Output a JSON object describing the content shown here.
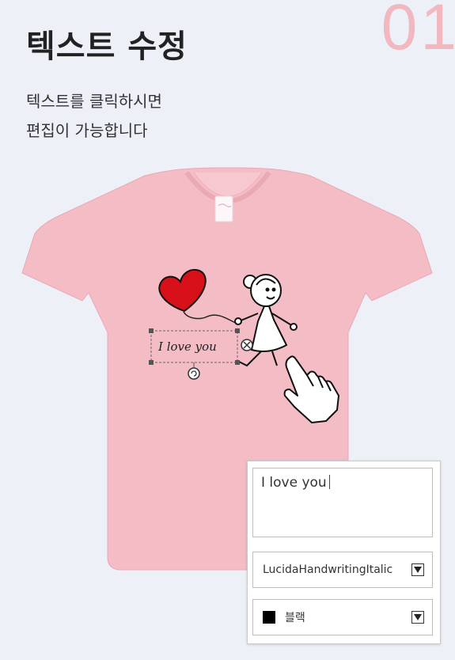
{
  "step": {
    "number": "01"
  },
  "header": {
    "title": "텍스트 수정"
  },
  "description": {
    "line1": "텍스트를 클릭하시면",
    "line2": "편집이 가능합니다"
  },
  "shirt": {
    "color": "#f4bcc5",
    "design_text": "I love you",
    "heart_color": "#d8101a"
  },
  "editor": {
    "text_value": "I love you",
    "font_value": "LucidaHandwritingItalic",
    "color_label": "블랙",
    "color_swatch": "#000000"
  },
  "icons": [
    "rotate-handle-icon",
    "delete-handle-icon",
    "pointing-hand-cursor-icon",
    "chevron-down-icon",
    "color-swatch-icon"
  ]
}
